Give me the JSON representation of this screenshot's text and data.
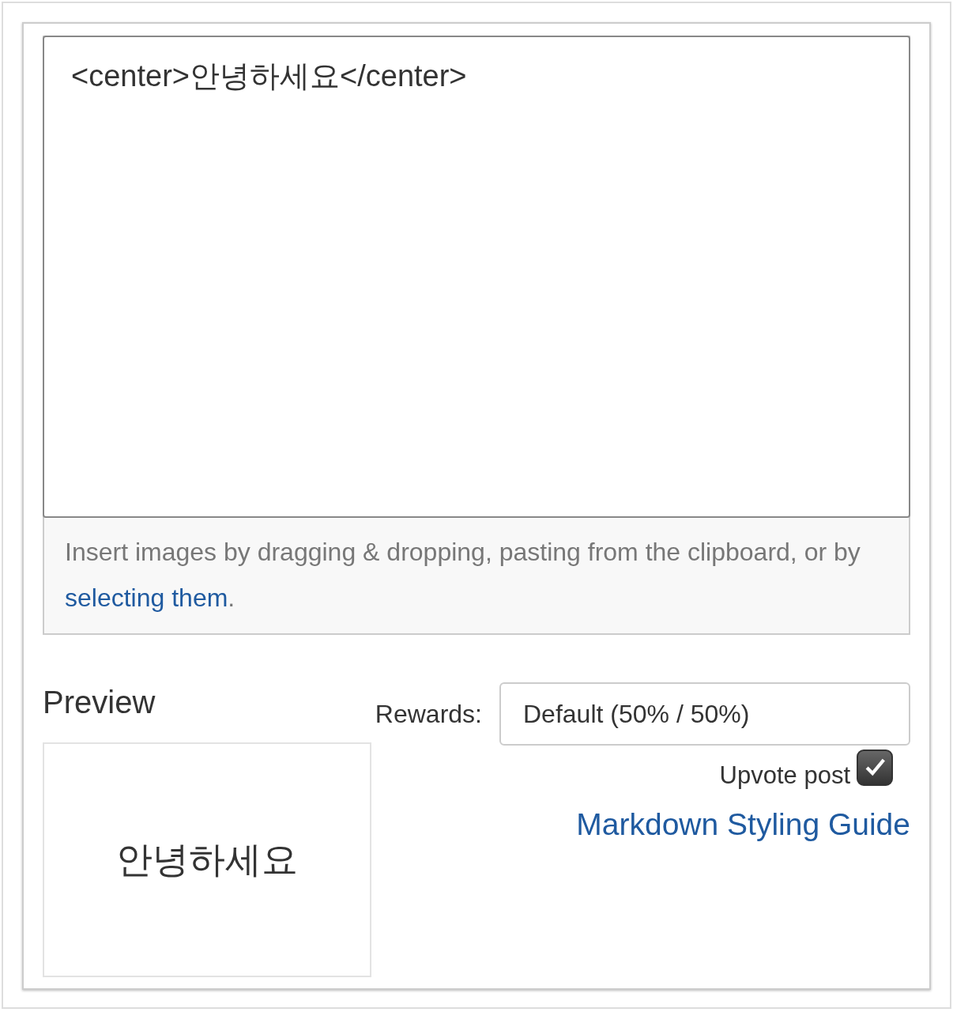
{
  "editor": {
    "value": "<center>안녕하세요</center>"
  },
  "hint": {
    "before": "Insert images by dragging & dropping, pasting from the clipboard, or by ",
    "link": "selecting them",
    "after": "."
  },
  "preview": {
    "title": "Preview",
    "content": "안녕하세요"
  },
  "rewards": {
    "label": "Rewards:",
    "value": "Default (50% / 50%)"
  },
  "upvote": {
    "label": "Upvote post",
    "checked": true
  },
  "guide_link": "Markdown Styling Guide"
}
